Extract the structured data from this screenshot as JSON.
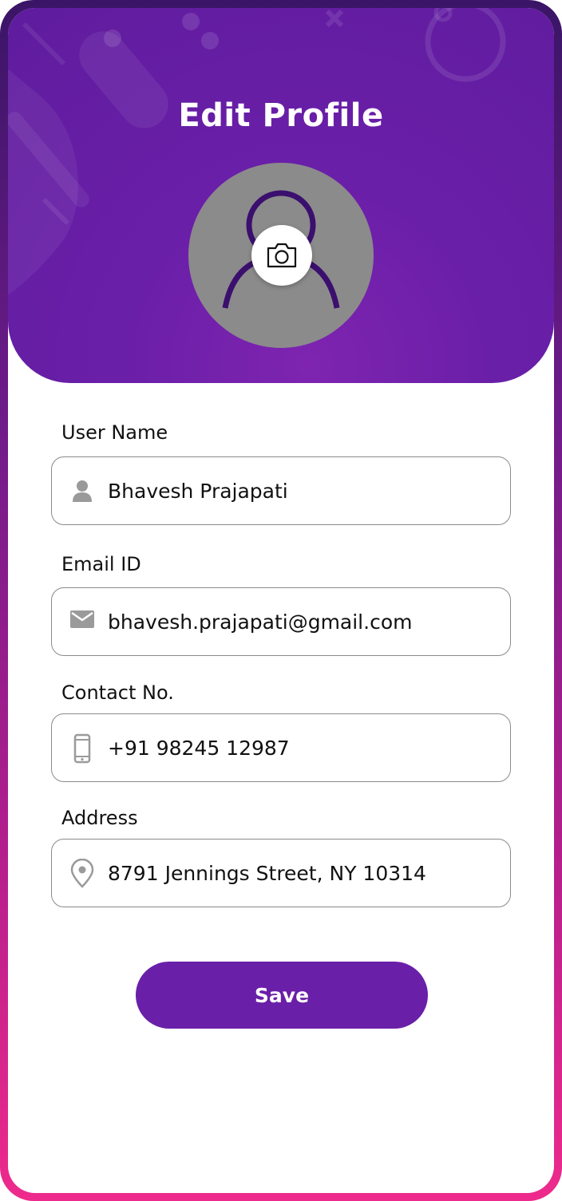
{
  "header": {
    "title": "Edit Profile"
  },
  "form": {
    "username": {
      "label": "User Name",
      "value": "Bhavesh Prajapati",
      "icon": "person-icon"
    },
    "email": {
      "label": "Email ID",
      "value": "bhavesh.prajapati@gmail.com",
      "icon": "mail-icon"
    },
    "contact": {
      "label": "Contact No.",
      "value": "+91 98245 12987",
      "icon": "phone-icon"
    },
    "address": {
      "label": "Address",
      "value": "8791 Jennings Street, NY 10314",
      "icon": "location-pin-icon"
    }
  },
  "actions": {
    "save_label": "Save"
  },
  "colors": {
    "primary": "#6a1fa8",
    "frame_top": "#3a1566",
    "frame_bottom": "#ee2a8c",
    "avatar_bg": "#8b8b8b",
    "icon_gray": "#9a9a9a"
  }
}
